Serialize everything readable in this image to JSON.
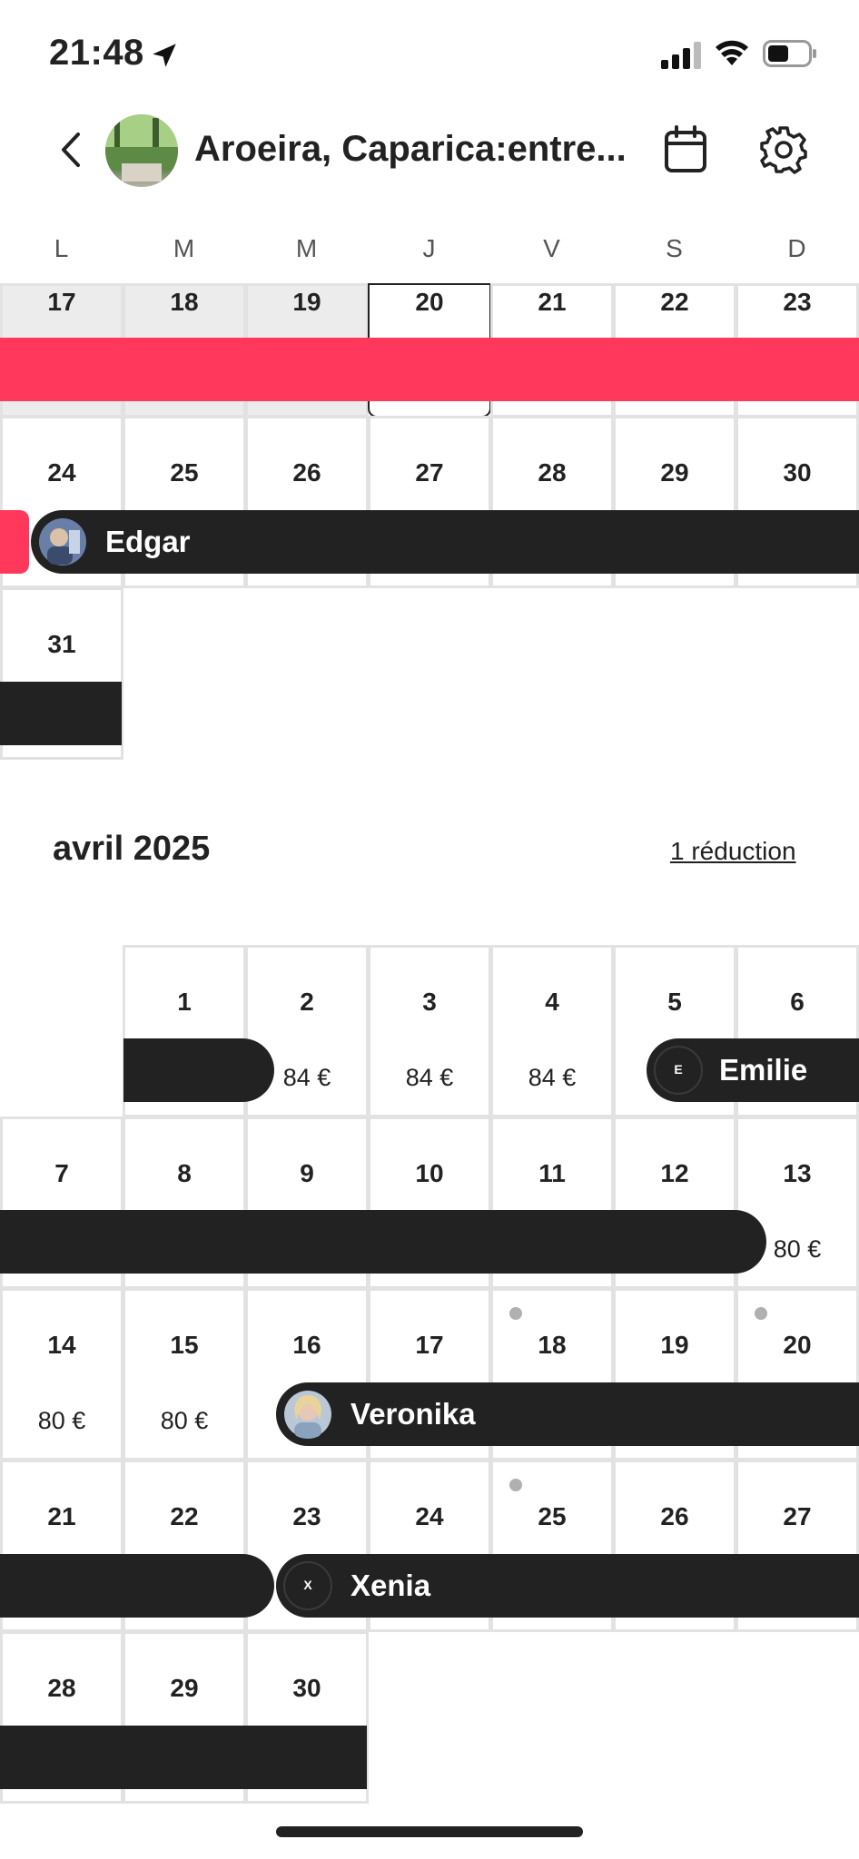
{
  "status_bar": {
    "time": "21:48"
  },
  "header": {
    "title": "Aroeira, Caparica:entre..."
  },
  "weekdays": [
    "L",
    "M",
    "M",
    "J",
    "V",
    "S",
    "D"
  ],
  "march_days": {
    "w1": [
      "17",
      "18",
      "19",
      "20",
      "21",
      "22",
      "23"
    ],
    "w2": [
      "24",
      "25",
      "26",
      "27",
      "28",
      "29",
      "30"
    ],
    "w3": [
      "31"
    ]
  },
  "march_guest": "Edgar",
  "april": {
    "title": "avril 2025",
    "discount_link": "1 réduction",
    "w1": [
      "1",
      "2",
      "3",
      "4",
      "5",
      "6"
    ],
    "w2": [
      "7",
      "8",
      "9",
      "10",
      "11",
      "12",
      "13"
    ],
    "w3": [
      "14",
      "15",
      "16",
      "17",
      "18",
      "19",
      "20"
    ],
    "w4": [
      "21",
      "22",
      "23",
      "24",
      "25",
      "26",
      "27"
    ],
    "w5": [
      "28",
      "29",
      "30"
    ],
    "prices": {
      "d2": "84 €",
      "d3": "84 €",
      "d4": "84 €",
      "d13": "80 €",
      "d14": "80 €",
      "d15": "80 €"
    },
    "guests": {
      "emilie": "Emilie",
      "emilie_initial": "E",
      "veronika": "Veronika",
      "xenia": "Xenia",
      "xenia_initial": "X"
    }
  },
  "colors": {
    "reservation_bar": "#222222",
    "blocked_bar": "#ff385c",
    "past_cell": "#ececec"
  },
  "icons": [
    "location-arrow-icon",
    "signal-icon",
    "wifi-icon",
    "battery-icon",
    "back-chevron-icon",
    "calendar-icon",
    "gear-icon"
  ]
}
